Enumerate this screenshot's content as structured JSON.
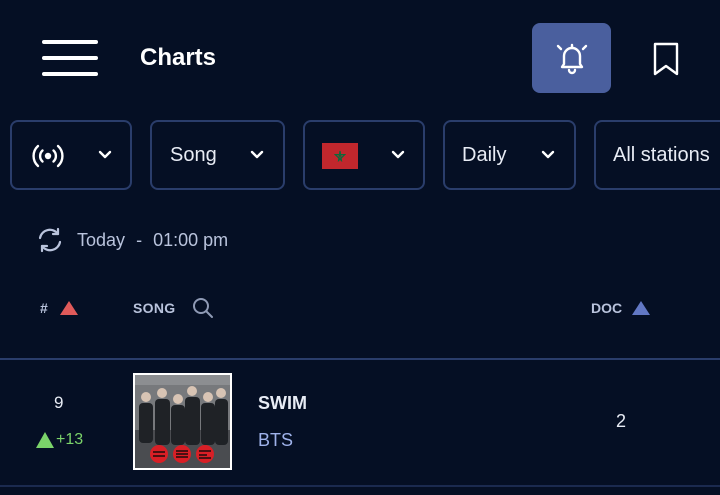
{
  "header": {
    "title": "Charts"
  },
  "filters": {
    "type_icon": "radio-broadcast-icon",
    "content_label": "Song",
    "country_flag": "morocco-flag",
    "period_label": "Daily",
    "stations_label": "All stations"
  },
  "update": {
    "day": "Today",
    "separator": "-",
    "time": "01:00 pm"
  },
  "columns": {
    "rank": "#",
    "song": "SONG",
    "doc": "DOC"
  },
  "rows": [
    {
      "rank": "9",
      "change": "+13",
      "title": "SWIM",
      "artist": "BTS",
      "doc": "2"
    }
  ],
  "colors": {
    "background": "#050f24",
    "accent": "#4a5f9e",
    "border": "#2a3d6b",
    "sort_red": "#e05a5a",
    "sort_blue": "#6278c4",
    "positive": "#7bd36a",
    "artist": "#9fb2ea"
  }
}
